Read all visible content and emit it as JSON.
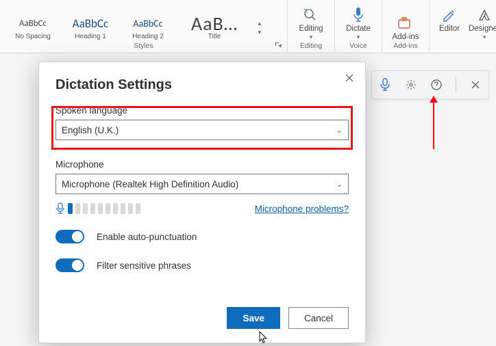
{
  "ribbon": {
    "styles": {
      "items": [
        {
          "preview": "AaBbCc",
          "label": "No Spacing"
        },
        {
          "preview": "AaBbCc",
          "label": "Heading 1"
        },
        {
          "preview": "AaBbCc",
          "label": "Heading 2"
        },
        {
          "preview": "AaB…",
          "label": "Title"
        }
      ],
      "group_label": "Styles"
    },
    "editing": {
      "label": "Editing",
      "group": "Editing"
    },
    "dictate": {
      "label": "Dictate",
      "group": "Voice"
    },
    "addins": {
      "label": "Add-ins",
      "group": "Add-ins"
    },
    "editor": {
      "label": "Editor"
    },
    "designer": {
      "label": "Designer"
    }
  },
  "modal": {
    "title": "Dictation Settings",
    "spoken_language_label": "Spoken language",
    "spoken_language_value": "English (U.K.)",
    "microphone_label": "Microphone",
    "microphone_value": "Microphone (Realtek High Definition Audio)",
    "mic_problems_link": "Microphone problems?",
    "auto_punct_label": "Enable auto-punctuation",
    "filter_label": "Filter sensitive phrases",
    "save_label": "Save",
    "cancel_label": "Cancel"
  }
}
